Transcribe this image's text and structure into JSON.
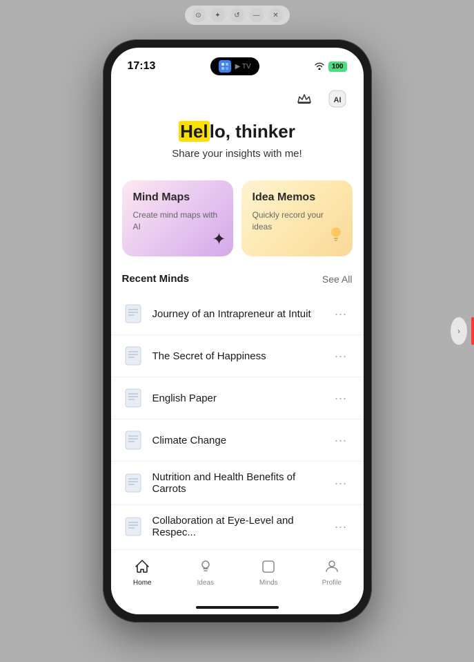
{
  "window": {
    "controls": {
      "btn1_label": "⊙",
      "btn2_label": "✦",
      "btn3_label": "↺",
      "minimize_label": "—",
      "close_label": "✕"
    }
  },
  "status_bar": {
    "time": "17:13",
    "apple_tv": "▶ TV",
    "wifi": "WiFi",
    "battery": "100"
  },
  "top_icons": {
    "crown_icon": "♛",
    "ai_icon": "AI"
  },
  "greeting": {
    "prefix": "",
    "highlighted": "Hel",
    "rest": "lo, thinker",
    "subtitle": "Share your insights with me!"
  },
  "cards": [
    {
      "id": "mind-maps",
      "title": "Mind Maps",
      "subtitle": "Create mind maps with AI",
      "icon": "✦"
    },
    {
      "id": "idea-memos",
      "title": "Idea Memos",
      "subtitle": "Quickly record your ideas",
      "icon": "💡"
    }
  ],
  "recent_minds": {
    "section_title": "Recent Minds",
    "see_all_label": "See All",
    "items": [
      {
        "id": 1,
        "title": "Journey of an Intrapreneur at Intuit"
      },
      {
        "id": 2,
        "title": "The Secret of Happiness"
      },
      {
        "id": 3,
        "title": "English Paper"
      },
      {
        "id": 4,
        "title": "Climate Change"
      },
      {
        "id": 5,
        "title": "Nutrition and Health Benefits of Carrots"
      },
      {
        "id": 6,
        "title": "Collaboration at Eye-Level and Respec..."
      }
    ]
  },
  "bottom_nav": {
    "items": [
      {
        "id": "home",
        "label": "Home",
        "active": true
      },
      {
        "id": "ideas",
        "label": "Ideas",
        "active": false
      },
      {
        "id": "minds",
        "label": "Minds",
        "active": false
      },
      {
        "id": "profile",
        "label": "Profile",
        "active": false
      }
    ]
  }
}
